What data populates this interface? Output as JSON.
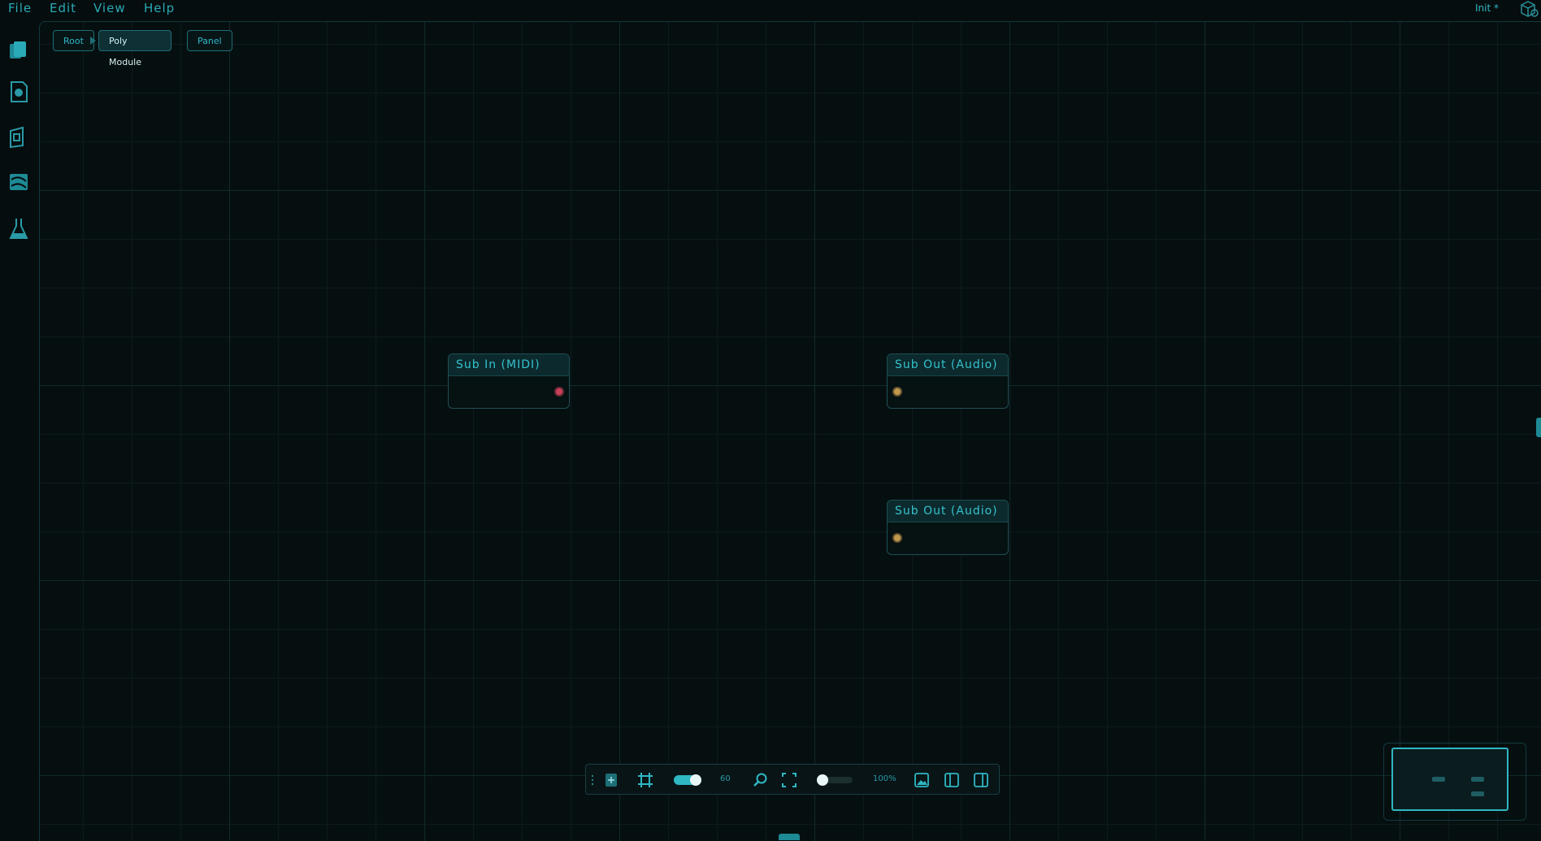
{
  "menu": {
    "file": "File",
    "edit": "Edit",
    "view": "View",
    "help": "Help"
  },
  "status": {
    "preset": "Init *"
  },
  "sidebar": {
    "icons": [
      "documents-icon",
      "module-file-icon",
      "panel-icon",
      "patch-cables-icon",
      "flask-icon"
    ]
  },
  "breadcrumb": {
    "root": "Root",
    "current": "Poly Module",
    "panel": "Panel"
  },
  "nodes": [
    {
      "title": "Sub In (MIDI)",
      "port": "midi-output"
    },
    {
      "title": "Sub Out (Audio)",
      "port": "audio-input"
    },
    {
      "title": "Sub Out (Audio)",
      "port": "audio-input"
    }
  ],
  "toolbar": {
    "grid_snap_enabled": true,
    "grid_size": "60",
    "zoom": "100%"
  },
  "colors": {
    "accent": "#2fb7c4",
    "midi_port": "#c9405a",
    "audio_port": "#c19a4e",
    "background": "#050d0e"
  }
}
